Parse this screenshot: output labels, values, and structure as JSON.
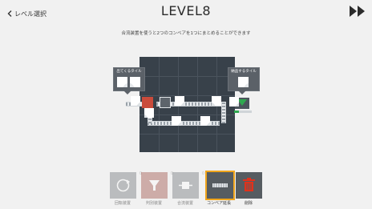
{
  "header": {
    "back_label": "レベル選択",
    "title": "LEVEL8"
  },
  "instruction": "合流装置を使うと2つのコンベアを1つにまとめることができます",
  "callouts": {
    "input_label": "出てくるタイル",
    "goal_label": "納品するタイル"
  },
  "toolbar": {
    "items": [
      {
        "label": "回転装置",
        "count": "0",
        "icon": "rotate-icon"
      },
      {
        "label": "判別装置",
        "count": "0",
        "icon": "filter-icon"
      },
      {
        "label": "合流装置",
        "count": "0",
        "icon": "merge-icon"
      },
      {
        "label": "コンベア延長",
        "icon": "conveyor-icon"
      },
      {
        "label": "削除",
        "icon": "trash-icon"
      }
    ],
    "selected_index": 3
  },
  "colors": {
    "accent": "#f0a51c",
    "board": "#38414a",
    "trash": "#e0321c",
    "goal": "#2fa84f"
  }
}
